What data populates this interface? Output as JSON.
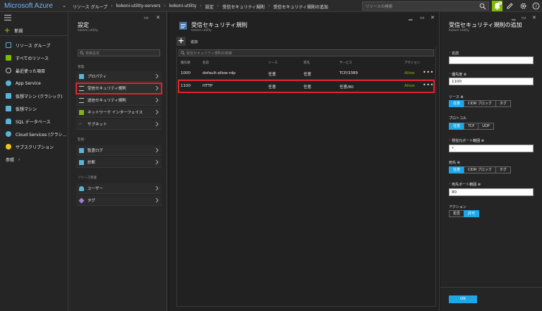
{
  "topbar": {
    "brand": "Microsoft Azure",
    "breadcrumbs": [
      "リソース グループ",
      "kokoni-utility-servers",
      "kokoni-utility",
      "設定",
      "受信セキュリティ規則",
      "受信セキュリティ規則の追加"
    ],
    "search_placeholder": "リソースの検索",
    "notification_count": "1"
  },
  "leftnav": {
    "new_label": "新規",
    "items": [
      {
        "label": "リソース グループ",
        "icon": "resource-group-icon",
        "color": "#59b4d9"
      },
      {
        "label": "すべてのリソース",
        "icon": "all-resources-icon",
        "color": "#7fba00"
      },
      {
        "label": "最近使った項目",
        "icon": "clock-icon",
        "color": "#c8c8c8"
      },
      {
        "label": "App Service",
        "icon": "app-service-icon",
        "color": "#59b4d9"
      },
      {
        "label": "仮想マシン (クラシック)",
        "icon": "vm-classic-icon",
        "color": "#59b4d9"
      },
      {
        "label": "仮想マシン",
        "icon": "vm-icon",
        "color": "#59b4d9"
      },
      {
        "label": "SQL データベース",
        "icon": "sql-icon",
        "color": "#59b4d9"
      },
      {
        "label": "Cloud Services (クラシ…",
        "icon": "cloud-icon",
        "color": "#59b4d9"
      },
      {
        "label": "サブスクリプション",
        "icon": "key-icon",
        "color": "#f0c419"
      }
    ],
    "more_label": "参照"
  },
  "settings": {
    "title": "設定",
    "subtitle": "kokoni-utility",
    "filter_placeholder": "検索設定",
    "sections": {
      "manage": "管理",
      "monitor": "監視",
      "resource_mgmt": "リソース管理"
    },
    "items": {
      "properties": "プロパティ",
      "inbound": "受信セキュリティ規則",
      "outbound": "送信セキュリティ規則",
      "nic": "ネットワーク インターフェイス",
      "subnet": "サブネット",
      "audit": "監査ログ",
      "diagnostics": "診断",
      "users": "ユーザー",
      "tags": "タグ"
    }
  },
  "rules": {
    "title": "受信セキュリティ規則",
    "subtitle": "kokoni-utility",
    "add_label": "追加",
    "filter_placeholder": "受信セキュリティ規則の検索",
    "columns": [
      "優先順",
      "名前",
      "ソース",
      "宛先",
      "サービス",
      "アクション"
    ],
    "rows": [
      {
        "priority": "1000",
        "name": "default-allow-rdp",
        "source": "任意",
        "dest": "任意",
        "service": "TCP/3389",
        "action": "Allow",
        "more": "•••"
      },
      {
        "priority": "1100",
        "name": "HTTP",
        "source": "任意",
        "dest": "任意",
        "service": "任意/80",
        "action": "Allow",
        "more": "•••"
      }
    ]
  },
  "addrule": {
    "title": "受信セキュリティ規則の追加",
    "subtitle": "kokoni-utility",
    "name_label": "名前",
    "name_value": "",
    "priority_label": "優先度",
    "priority_value": "1100",
    "source_label": "ソース",
    "source_options": [
      "任意",
      "CIDR ブロック",
      "タグ"
    ],
    "protocol_label": "プロトコル",
    "protocol_options": [
      "任意",
      "TCP",
      "UDP"
    ],
    "src_port_label": "発信元ポート範囲",
    "src_port_value": "*",
    "dest_label": "宛先",
    "dest_options": [
      "任意",
      "CIDR ブロック",
      "タグ"
    ],
    "dest_port_label": "宛先ポート範囲",
    "dest_port_value": "80",
    "action_label": "アクション",
    "action_options": [
      "拒否",
      "許可"
    ],
    "ok_label": "OK"
  },
  "colors": {
    "accent": "#1ea7e8",
    "allow": "#7fba00",
    "highlight": "#e0232f",
    "brand": "#6ab5ff"
  }
}
